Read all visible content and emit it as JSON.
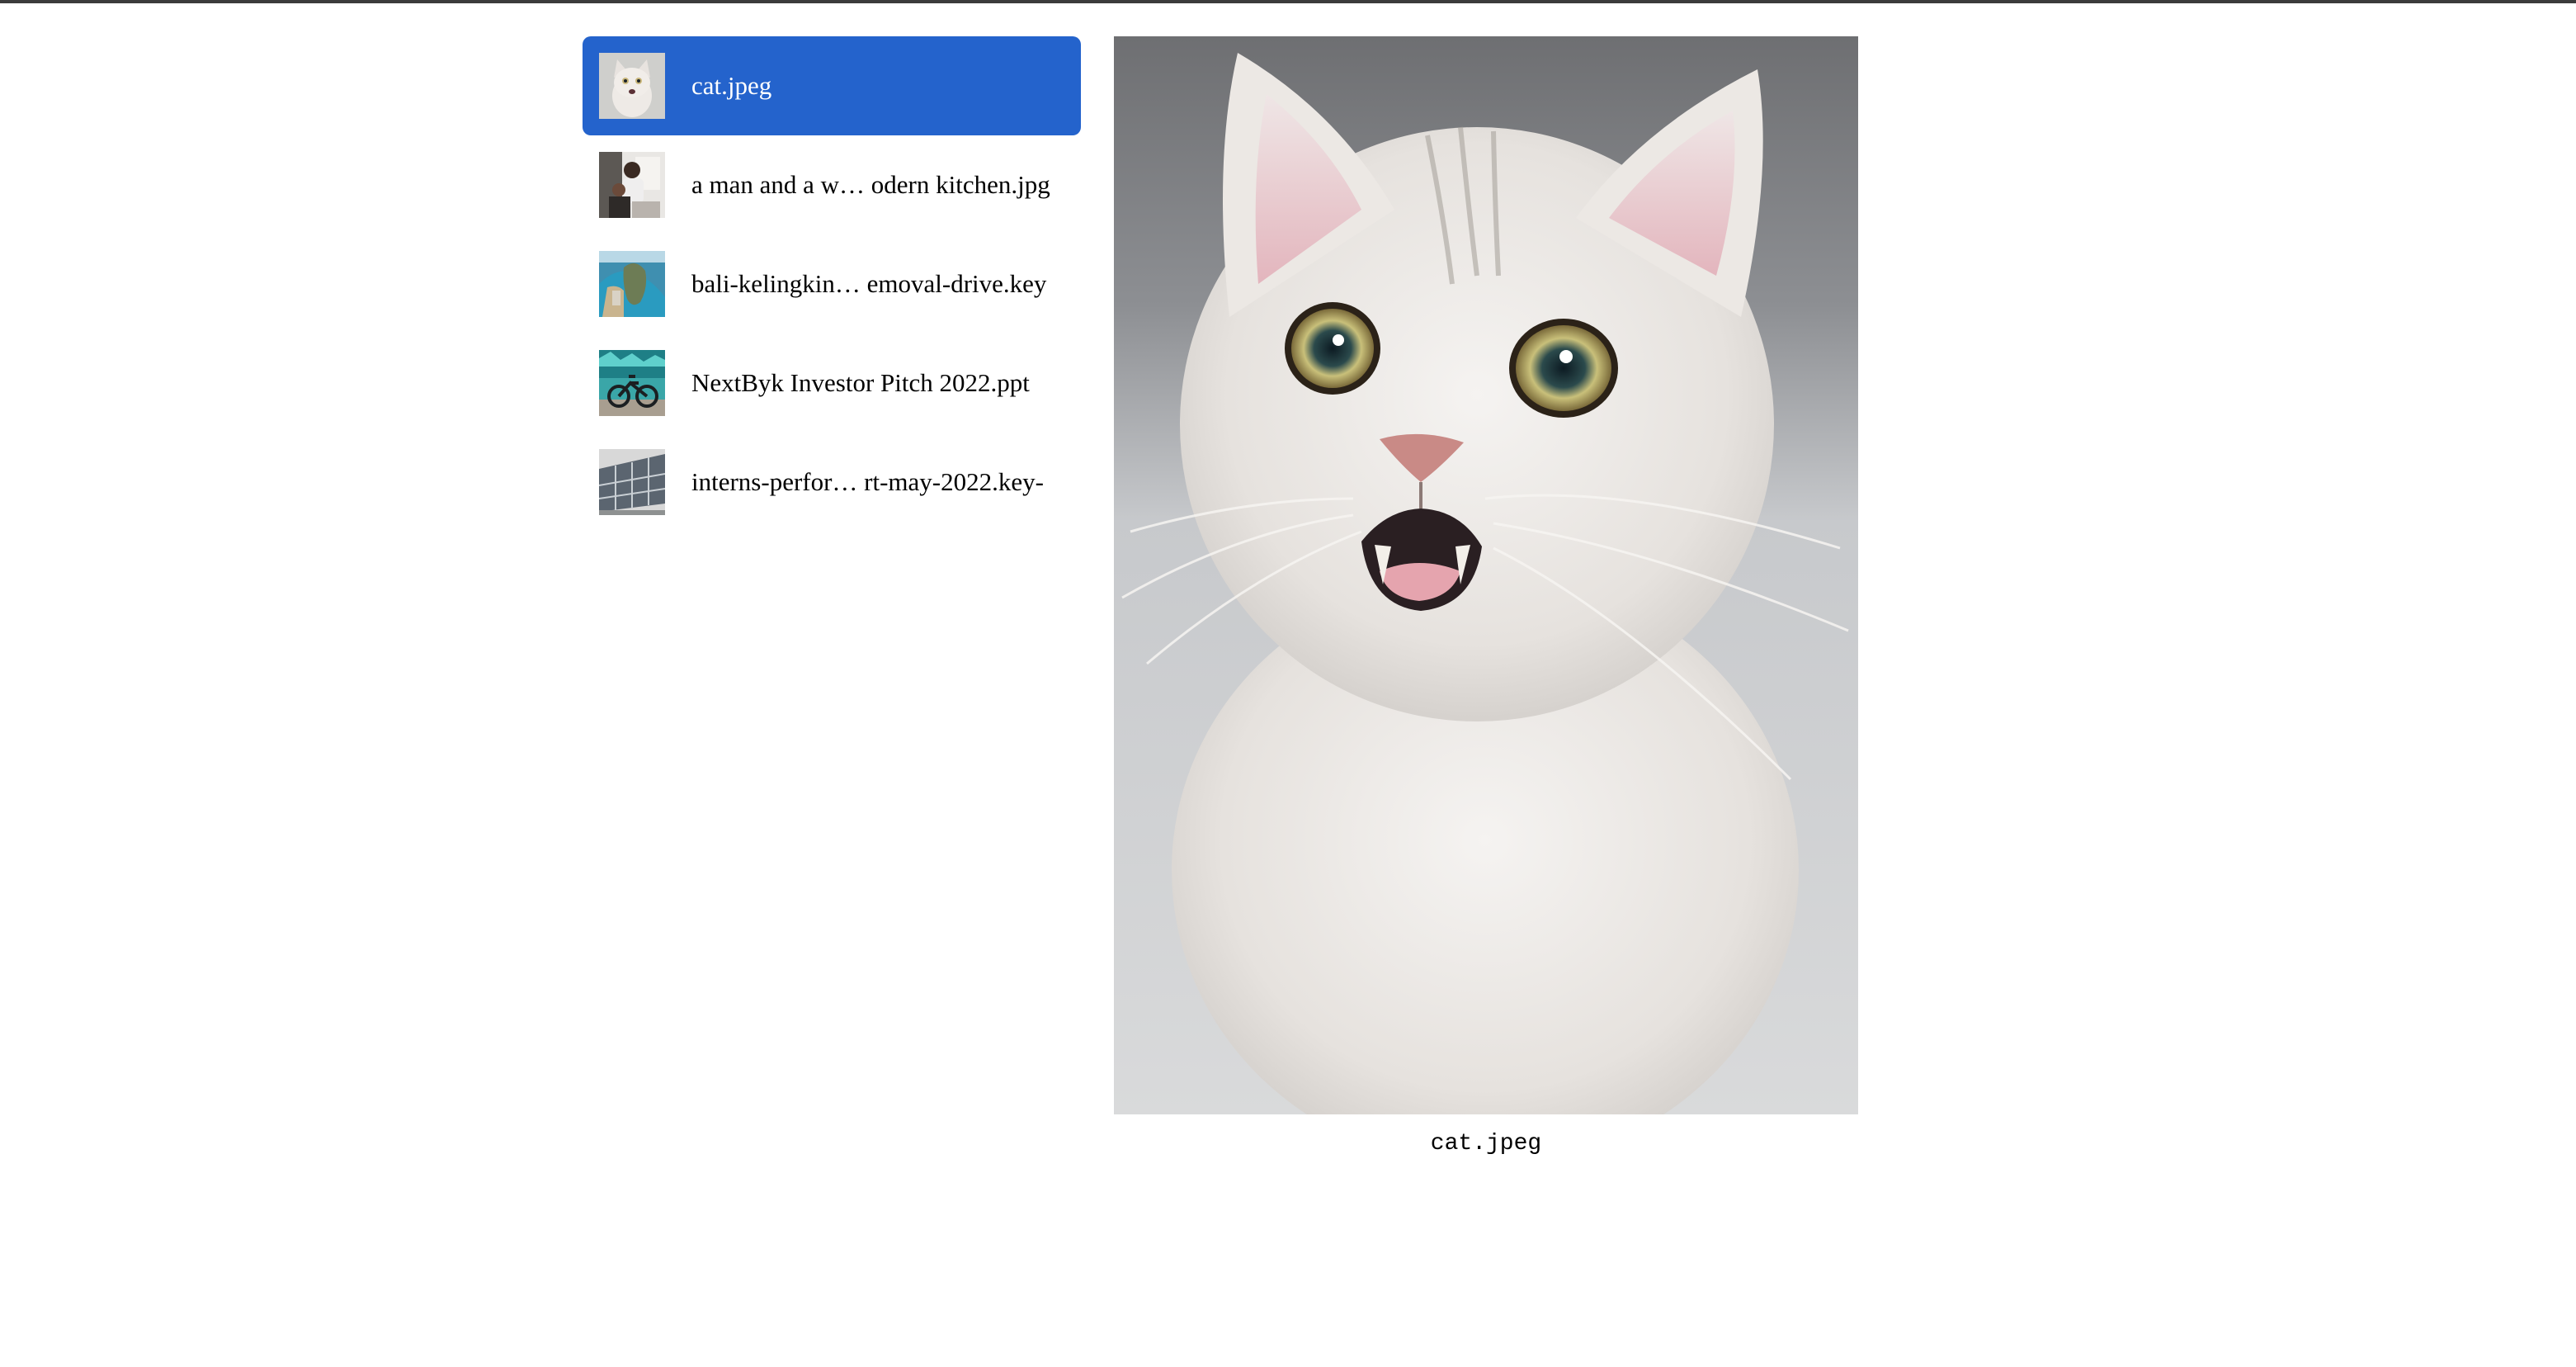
{
  "files": [
    {
      "name": "cat.jpeg",
      "selected": true,
      "thumb_icon": "cat-thumbnail-icon"
    },
    {
      "name": "a man and a w… odern kitchen.jpg",
      "selected": false,
      "thumb_icon": "kitchen-thumbnail-icon"
    },
    {
      "name": "bali-kelingkin…  emoval-drive.key",
      "selected": false,
      "thumb_icon": "beach-thumbnail-icon"
    },
    {
      "name": "NextByk Investor Pitch 2022.ppt",
      "selected": false,
      "thumb_icon": "bike-thumbnail-icon"
    },
    {
      "name": "interns-perfor…  rt-may-2022.key-",
      "selected": false,
      "thumb_icon": "solar-thumbnail-icon"
    }
  ],
  "preview": {
    "caption": "cat.jpeg",
    "image_icon": "cat-photo"
  },
  "colors": {
    "selected_bg": "#2463cc",
    "top_rule": "#3c3c3c"
  }
}
